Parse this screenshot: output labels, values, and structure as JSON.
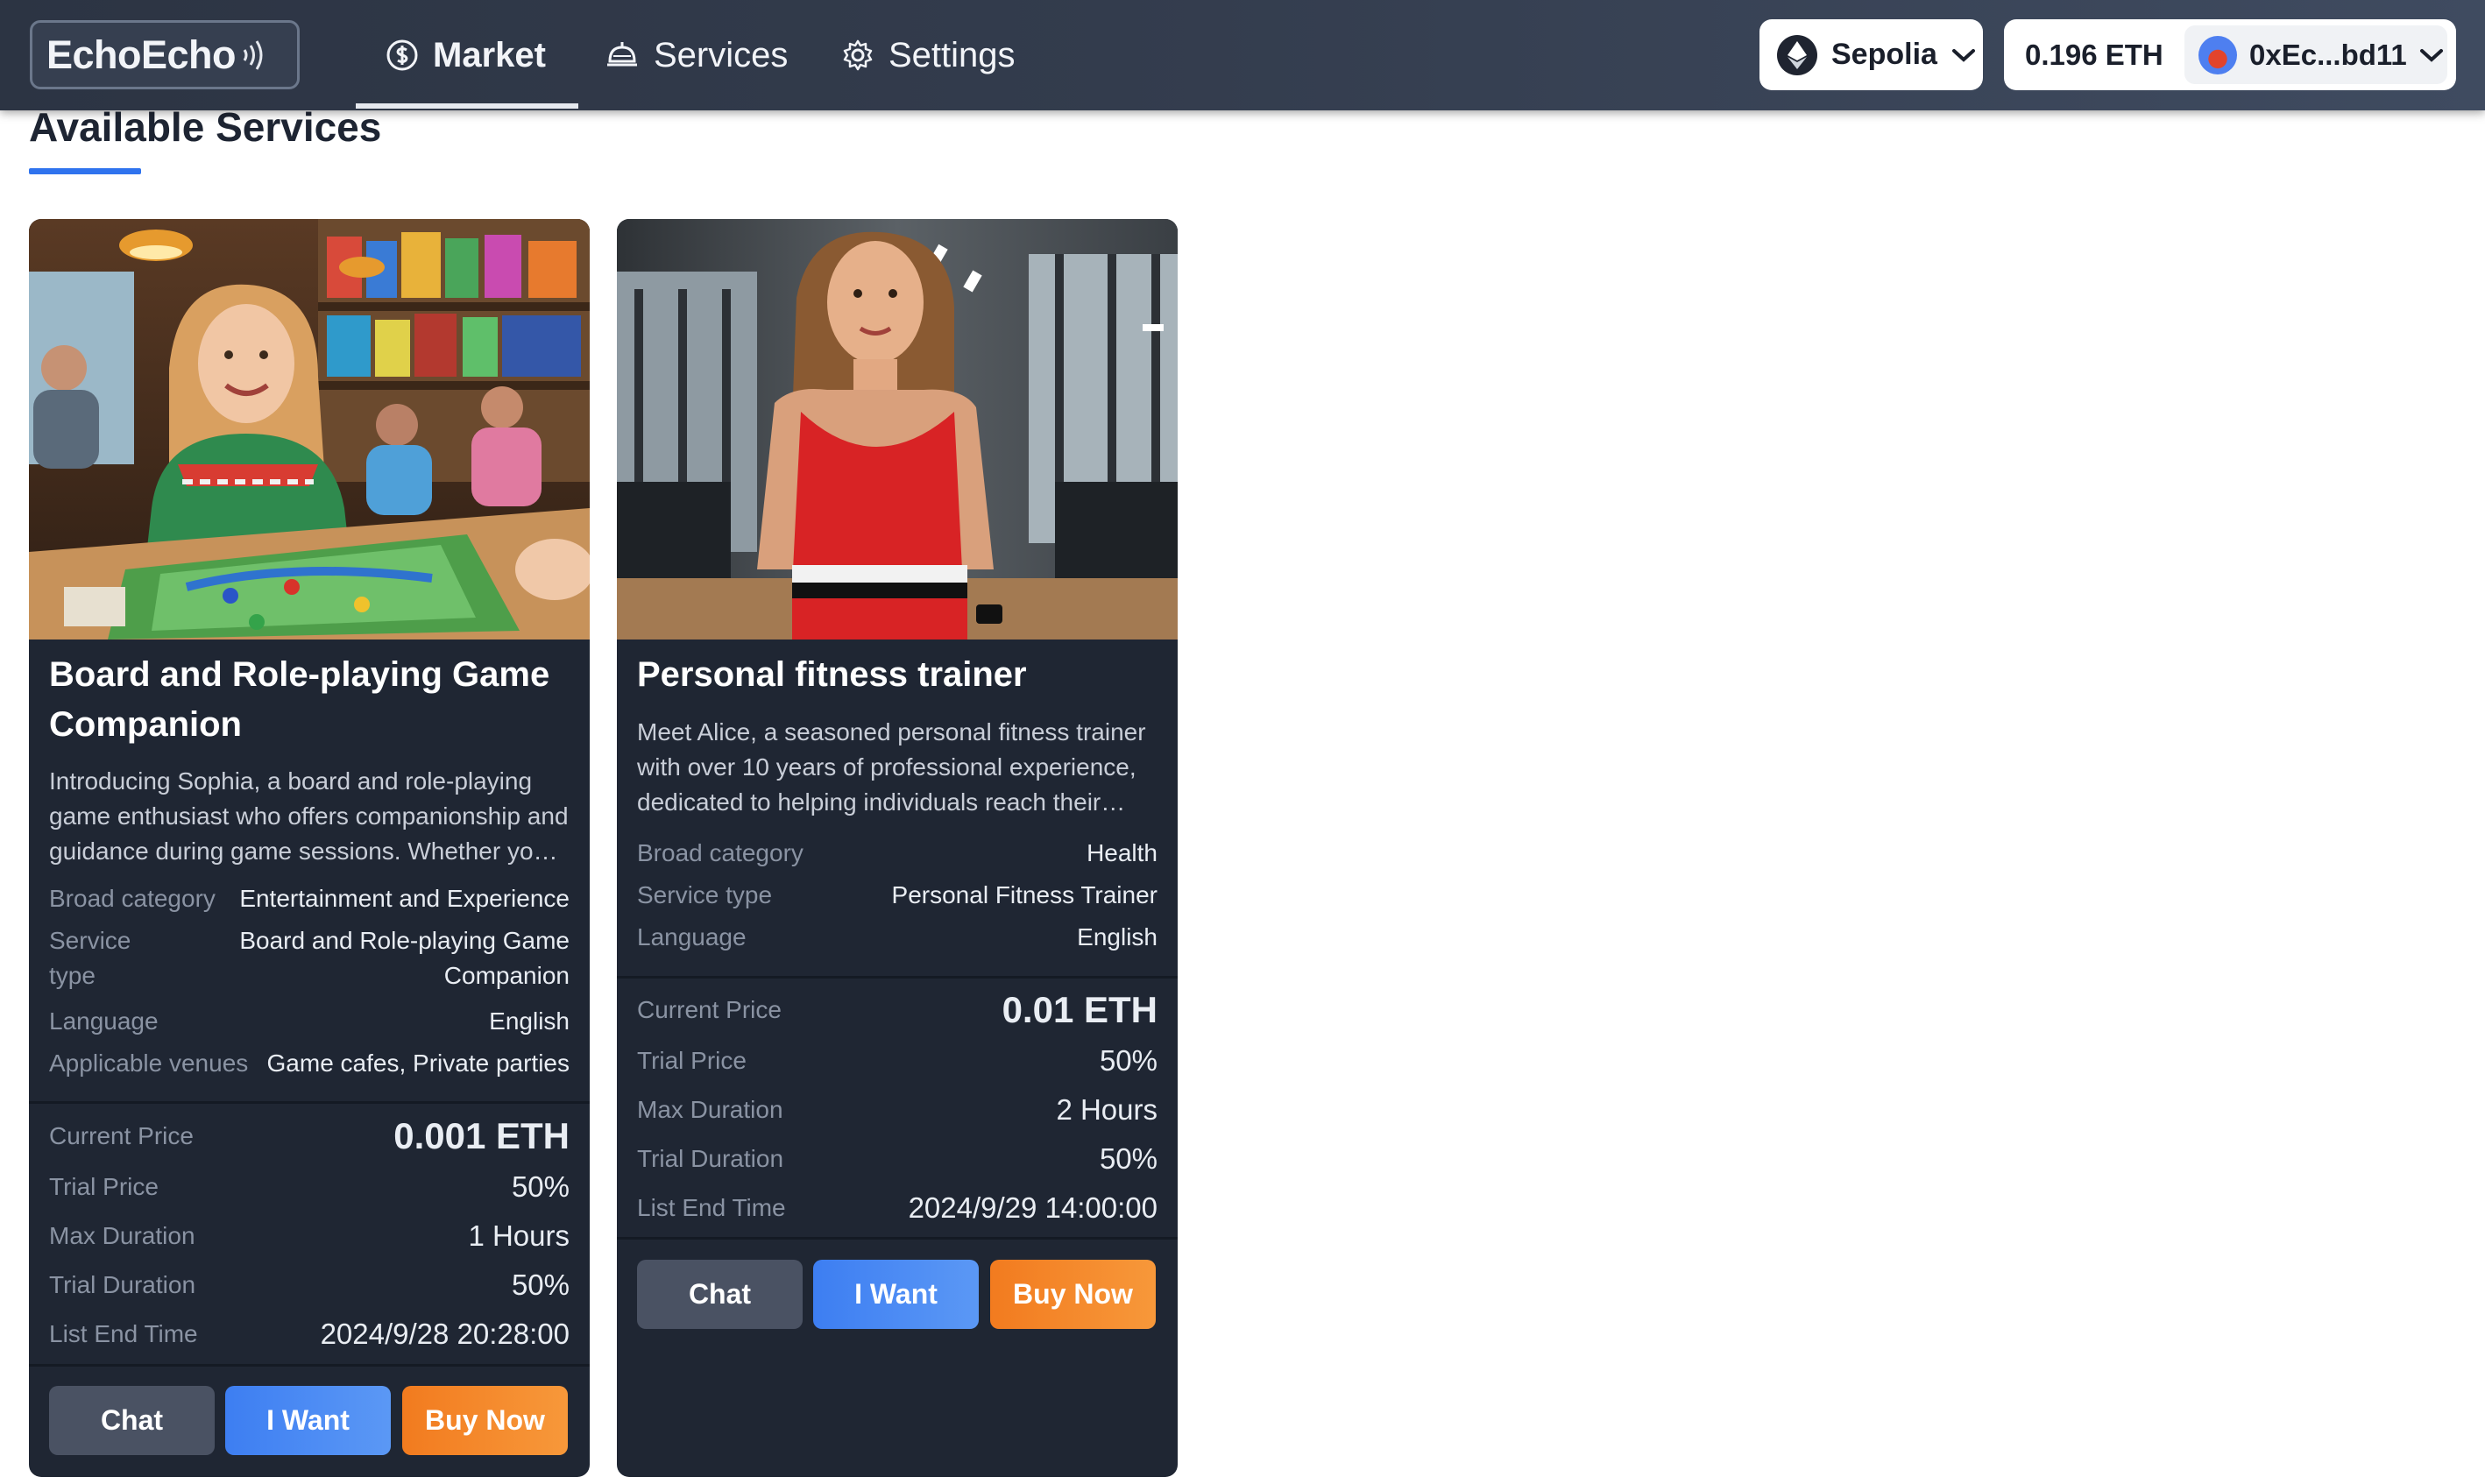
{
  "app": {
    "logo_text": "EchoEcho"
  },
  "nav": {
    "tabs": [
      {
        "label": "Market",
        "icon": "dollar-coin-icon",
        "active": true
      },
      {
        "label": "Services",
        "icon": "service-bell-icon",
        "active": false
      },
      {
        "label": "Settings",
        "icon": "gear-icon",
        "active": false
      }
    ]
  },
  "wallet": {
    "network": "Sepolia",
    "network_icon": "ethereum-icon",
    "balance": "0.196 ETH",
    "address": "0xEc...bd11"
  },
  "page": {
    "title": "Available Services"
  },
  "colors": {
    "navbar": "#333c4d",
    "card_bg": "#1f2633",
    "accent_blue": "#2f73ee",
    "button_chat": "#4a5263",
    "button_want": "#3d7ef2",
    "button_buy": "#f27b1f"
  },
  "services": [
    {
      "title": "Board and Role-playing Game Companion",
      "image": "board-game-cafe-photo",
      "description": "Introducing Sophia, a board and role-playing game enthusiast who offers companionship and guidance during game sessions. Whether you prefer strategy or story, she is ready to play.",
      "details": [
        {
          "label": "Broad category",
          "value": "Entertainment and Experience"
        },
        {
          "label": "Service type",
          "value": "Board and Role-playing Game Companion"
        },
        {
          "label": "Language",
          "value": "English"
        },
        {
          "label": "Applicable venues",
          "value": "Game cafes, Private parties"
        }
      ],
      "pricing": [
        {
          "label": "Current Price",
          "value": "0.001 ETH"
        },
        {
          "label": "Trial Price",
          "value": "50%"
        },
        {
          "label": "Max Duration",
          "value": "1 Hours"
        },
        {
          "label": "Trial Duration",
          "value": "50%"
        },
        {
          "label": "List End Time",
          "value": "2024/9/28 20:28:00"
        }
      ],
      "buttons": {
        "chat": "Chat",
        "want": "I Want",
        "buy": "Buy Now"
      }
    },
    {
      "title": "Personal fitness trainer",
      "image": "gym-trainer-photo",
      "description": "Meet Alice, a seasoned personal fitness trainer with over 10 years of professional experience, dedicated to helping individuals reach their health and fitness goals.",
      "details": [
        {
          "label": "Broad category",
          "value": "Health"
        },
        {
          "label": "Service type",
          "value": "Personal Fitness Trainer"
        },
        {
          "label": "Language",
          "value": "English"
        }
      ],
      "pricing": [
        {
          "label": "Current Price",
          "value": "0.01 ETH"
        },
        {
          "label": "Trial Price",
          "value": "50%"
        },
        {
          "label": "Max Duration",
          "value": "2 Hours"
        },
        {
          "label": "Trial Duration",
          "value": "50%"
        },
        {
          "label": "List End Time",
          "value": "2024/9/29 14:00:00"
        }
      ],
      "buttons": {
        "chat": "Chat",
        "want": "I Want",
        "buy": "Buy Now"
      }
    }
  ]
}
